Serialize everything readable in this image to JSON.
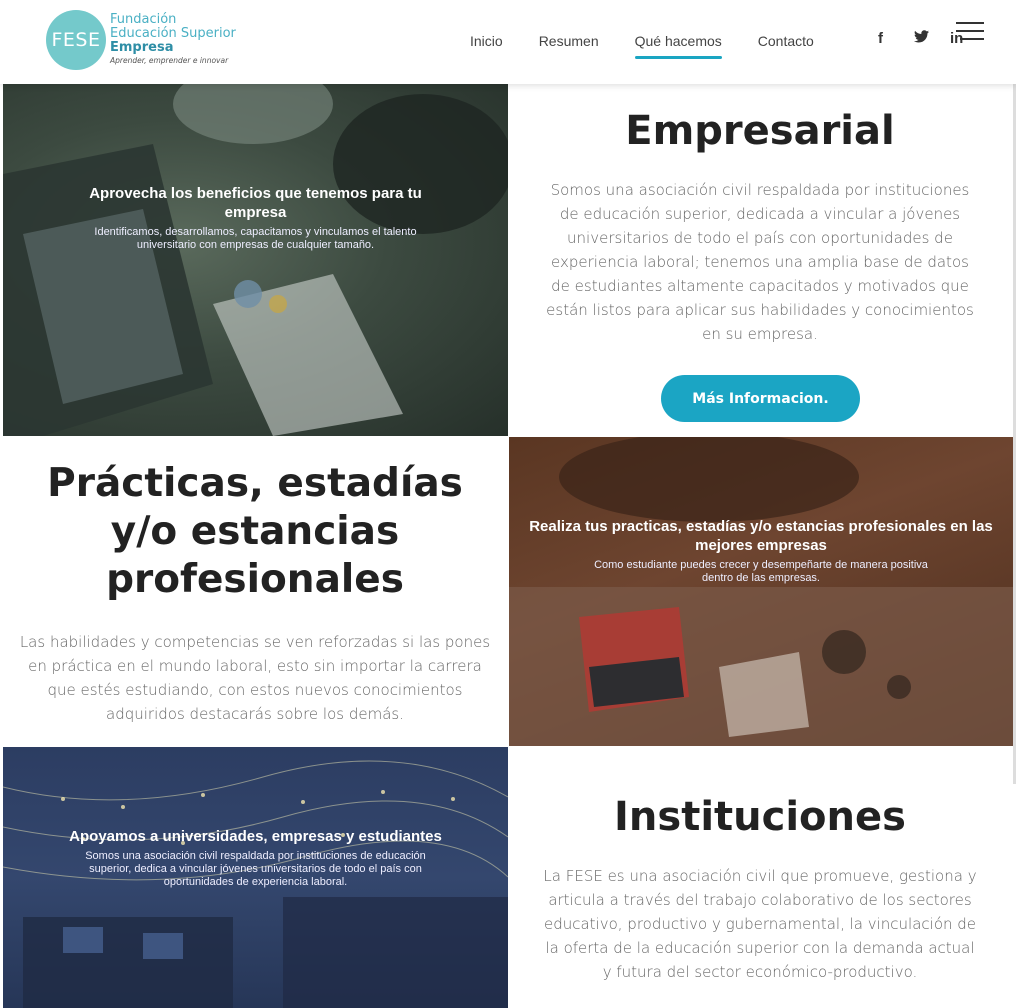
{
  "header": {
    "logo": {
      "mark": "FESE",
      "line1": "Fundación",
      "line2": "Educación Superior",
      "line3": "Empresa",
      "tagline": "Aprender, emprender e innovar"
    },
    "nav": [
      {
        "label": "Inicio"
      },
      {
        "label": "Resumen"
      },
      {
        "label": "Qué hacemos"
      },
      {
        "label": "Contacto"
      }
    ],
    "social": {
      "facebook": "f",
      "twitter": "🐦",
      "linkedin": "in"
    },
    "accent_color": "#1aa5c2"
  },
  "sections": {
    "business": {
      "image_title": "Aprovecha los beneficios que tenemos para tu empresa",
      "image_text": "Identificamos, desarrollamos, capacitamos y vinculamos el talento universitario con empresas de cualquier tamaño.",
      "heading": "Empresarial",
      "body": "Somos una asociación civil respaldada por instituciones de educación superior, dedicada a vincular a jóvenes universitarios de todo el país con oportunidades de experiencia laboral; tenemos una amplia base de datos de estudiantes altamente capacitados y motivados que están listos para aplicar sus habilidades y conocimientos en su empresa.",
      "button": "Más Informacion."
    },
    "practice": {
      "heading": "Prácticas, estadías y/o estancias profesionales",
      "body": "Las habilidades y competencias se ven reforzadas si las pones en práctica en el mundo laboral, esto sin importar la carrera que estés estudiando, con estos nuevos conocimientos adquiridos destacarás sobre los demás.",
      "image_title": "Realiza tus practicas, estadías y/o estancias profesionales en las mejores empresas",
      "image_text": "Como estudiante puedes crecer y desempeñarte de manera positiva dentro de las empresas."
    },
    "institutions": {
      "image_title": "Apoyamos a universidades, empresas y estudiantes",
      "image_text": "Somos una asociación civil respaldada por instituciones de educación superior, dedica a vincular jóvenes universitarios de todo el país con oportunidades de experiencia laboral.",
      "heading": "Instituciones",
      "body": "La FESE es una asociación civil que promueve, gestiona y articula a través del trabajo colaborativo de los sectores educativo, productivo y gubernamental, la vinculación de la oferta de la educación superior con la demanda actual y futura del sector económico-productivo."
    }
  }
}
